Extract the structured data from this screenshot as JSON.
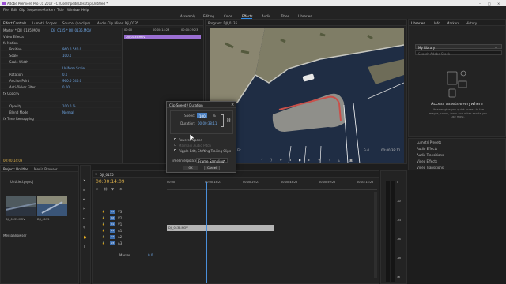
{
  "app": {
    "title": "Adobe Premiere Pro CC 2017 - C:\\Users\\pedr\\Desktop\\Untitled *",
    "window_controls": [
      "–",
      "□",
      "×"
    ]
  },
  "menu": [
    "File",
    "Edit",
    "Clip",
    "Sequence",
    "Markers",
    "Title",
    "Window",
    "Help"
  ],
  "workspaces": [
    "Assembly",
    "Editing",
    "Color",
    "Effects",
    "Audio",
    "Titles",
    "Libraries"
  ],
  "active_workspace": "Effects",
  "effect_controls": {
    "tabs": [
      "Effect Controls",
      "Lumetri Scopes",
      "Source: (no clips)",
      "Audio Clip Mixer: Dji_0135"
    ],
    "master_label": "Master * DJI_0135.MOV",
    "clip_label": "Dji_0135 * DJI_0135.MOV",
    "section": "Video Effects",
    "rows": [
      {
        "name": "fx Motion",
        "value": "",
        "indent": 0
      },
      {
        "name": "Position",
        "value": "960.0   540.0",
        "indent": 1
      },
      {
        "name": "Scale",
        "value": "100.0",
        "indent": 1
      },
      {
        "name": "Scale Width",
        "value": "",
        "indent": 1
      },
      {
        "name": "",
        "value": "Uniform Scale",
        "indent": 1
      },
      {
        "name": "Rotation",
        "value": "0.0",
        "indent": 1
      },
      {
        "name": "Anchor Point",
        "value": "960.0   540.0",
        "indent": 1
      },
      {
        "name": "Anti-flicker Filter",
        "value": "0.00",
        "indent": 1
      },
      {
        "name": "fx Opacity",
        "value": "",
        "indent": 0
      },
      {
        "name": "",
        "value": "",
        "indent": 1
      },
      {
        "name": "Opacity",
        "value": "100.0 %",
        "indent": 1
      },
      {
        "name": "Blend Mode",
        "value": "Normal",
        "indent": 1
      },
      {
        "name": "fx Time Remapping",
        "value": "",
        "indent": 0
      }
    ],
    "timeline_ticks": [
      "00:00",
      "00:00:14:23",
      "00:00:29:23"
    ],
    "mini_clip": "DJI_0135.MOV",
    "timecode": "00:00:14:09"
  },
  "program": {
    "title": "Program: DJI_0135",
    "timecode_left": "00:00:14:09",
    "fit": "Fit",
    "timecode_right": "00:00:38:11",
    "quality": "Full"
  },
  "dialog": {
    "title": "Clip Speed / Duration",
    "speed_label": "Speed:",
    "speed_value": "100",
    "speed_unit": "%",
    "duration_label": "Duration:",
    "duration_value": "00:00:38:11",
    "checkboxes": [
      {
        "label": "Reverse Speed",
        "checked": false,
        "enabled": true
      },
      {
        "label": "Maintain Audio Pitch",
        "checked": false,
        "enabled": false
      },
      {
        "label": "Ripple Edit, Shifting Trailing Clips",
        "checked": false,
        "enabled": true
      }
    ],
    "interp_label": "Time Interpolation:",
    "interp_value": "Frame Sampling",
    "ok": "OK",
    "cancel": "Cancel"
  },
  "libraries": {
    "tabs": [
      "Libraries",
      "Info",
      "Markers",
      "History"
    ],
    "library_name": "My Library",
    "search_placeholder": "Search Adobe Stock",
    "headline": "Access assets everywhere",
    "body": "Libraries give you quick access to the images, colors, fonts and other assets you use most."
  },
  "effects_panel": {
    "rows": [
      "Lumetri Presets",
      "Audio Effects",
      "Audio Transitions",
      "Video Effects",
      "Video Transitions"
    ]
  },
  "project": {
    "tabs": [
      "Project: Untitled",
      "Media Browser"
    ],
    "file": "Untitled.prproj",
    "items": [
      "DJI_0135.MOV",
      "DJI_0135"
    ],
    "footer": "Media Browser"
  },
  "timeline": {
    "tabs": [
      "DJI_0135"
    ],
    "timecode": "00:00:14:09",
    "ruler": [
      "00:00",
      "00:00:14:23",
      "00:00:29:23",
      "00:00:44:22",
      "00:00:59:22",
      "00:01:14:22"
    ],
    "video_tracks": [
      "V3",
      "V2",
      "V1"
    ],
    "audio_tracks": [
      "A1",
      "A2",
      "A3"
    ],
    "clip": "DJI_0135.MOV",
    "master": "Master",
    "master_value": "0.0"
  },
  "meter": {
    "labels": [
      "0",
      "-12",
      "-24",
      "-36",
      "-48",
      "dB"
    ]
  }
}
